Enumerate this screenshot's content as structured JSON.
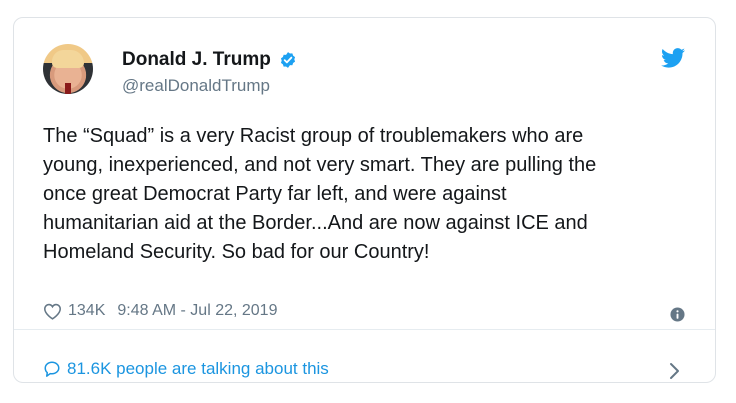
{
  "author": {
    "name": "Donald J. Trump",
    "handle": "@realDonaldTrump"
  },
  "tweet": {
    "text": "The “Squad” is a very Racist group of troublemakers who are\nyoung, inexperienced, and not very smart. They are pulling the\nonce great Democrat Party far left, and were against\nhumanitarian aid at the Border...And are now against ICE and\nHomeland Security. So bad for our Country!",
    "likes": "134K",
    "timestamp": "9:48 AM - Jul 22, 2019"
  },
  "conversation": {
    "label": "81.6K people are talking about this"
  },
  "colors": {
    "accent": "#1b95e0",
    "text": "#14171a",
    "secondary": "#657786",
    "verified": "#1da1f2"
  },
  "icons": [
    "verified-badge-icon",
    "twitter-bird-icon",
    "heart-icon",
    "info-icon",
    "speech-bubble-icon",
    "chevron-right-icon"
  ]
}
